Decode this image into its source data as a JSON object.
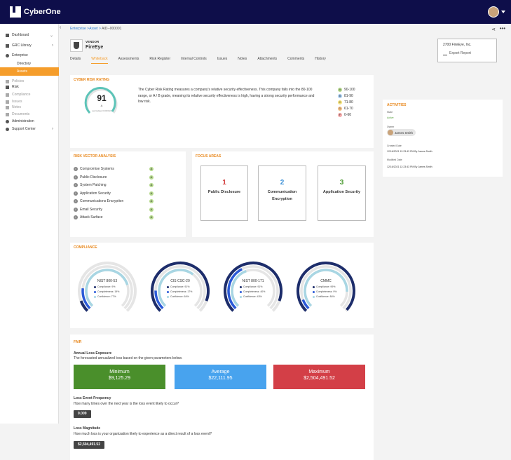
{
  "brand": {
    "name": "CyberOne"
  },
  "sidebar": {
    "items": [
      {
        "label": "Dashboard",
        "icon": "grid-icon",
        "chev": "⌄"
      },
      {
        "label": "GRC Library",
        "icon": "library-icon",
        "chev": "›"
      },
      {
        "label": "Enterprise",
        "icon": "globe-icon",
        "chev": ""
      },
      {
        "label": "Directory",
        "icon": "",
        "chev": ""
      },
      {
        "label": "Assets",
        "icon": "",
        "chev": ""
      },
      {
        "label": "Policies",
        "icon": "link-icon",
        "chev": ""
      },
      {
        "label": "Risk",
        "icon": "list-icon",
        "chev": ""
      },
      {
        "label": "Compliance",
        "icon": "doc-icon",
        "chev": ""
      },
      {
        "label": "Issues",
        "icon": "flag-icon",
        "chev": ""
      },
      {
        "label": "Notes",
        "icon": "note-icon",
        "chev": ""
      },
      {
        "label": "Documents",
        "icon": "file-icon",
        "chev": ""
      },
      {
        "label": "Administration",
        "icon": "gear-icon",
        "chev": ""
      },
      {
        "label": "Support Center",
        "icon": "help-icon",
        "chev": "›"
      }
    ]
  },
  "breadcrumb": {
    "part1": "Enterprise",
    "sep1": " >",
    "part2": "Asset",
    "sep2": " > ",
    "current": "AID--000001"
  },
  "vendor": {
    "type": "VENDOR",
    "name": "FireEye"
  },
  "tabs": [
    "Details",
    "Whiteback",
    "Assessments",
    "Risk Register",
    "Internal Controls",
    "Issues",
    "Notes",
    "Attachments",
    "Comments",
    "History"
  ],
  "address": {
    "text": "2700 FireEye, Inc.",
    "export": "Export Report"
  },
  "rating": {
    "title": "CYBER RISK RATING",
    "score": "91",
    "grade": "A",
    "updated": "Last Updated 01/06/2021",
    "text": "The Cyber Risk Rating measures a company's relative security effectiveness. This company falls into the 80-100 range, or A / B grade, meaning its relative security effectiveness is high, having a strong security performance and low risk.",
    "legend": [
      {
        "g": "A",
        "range": "90-100",
        "color": "#b5d98c"
      },
      {
        "g": "B",
        "range": "81-90",
        "color": "#a9cdf0"
      },
      {
        "g": "C",
        "range": "71-80",
        "color": "#f4e27a"
      },
      {
        "g": "D",
        "range": "61-70",
        "color": "#f6c185"
      },
      {
        "g": "F",
        "range": "0-60",
        "color": "#f2a7a7"
      }
    ]
  },
  "vectors": {
    "title": "RISK VECTOR ANALYSIS",
    "items": [
      {
        "label": "Compromise Systems",
        "grade": "A"
      },
      {
        "label": "Public Disclosure",
        "grade": "A"
      },
      {
        "label": "System Patching",
        "grade": "A"
      },
      {
        "label": "Application Security",
        "grade": "A"
      },
      {
        "label": "Communications Encryption",
        "grade": "A"
      },
      {
        "label": "Email Security",
        "grade": "A"
      },
      {
        "label": "Attack Surface",
        "grade": "A"
      }
    ]
  },
  "focus": {
    "title": "FOCUS AREAS",
    "items": [
      {
        "n": "1",
        "label": "Public Disclosure",
        "color": "#d13c3c"
      },
      {
        "n": "2",
        "label": "Communication Encryption",
        "color": "#3a8fd6"
      },
      {
        "n": "3",
        "label": "Application Security",
        "color": "#4a9a2f"
      }
    ]
  },
  "compliance": {
    "title": "COMPLIANCE",
    "frameworks": [
      {
        "name": "NIST 800-53",
        "compliance": "Compliance: 9%",
        "completeness": "Completeness: 19%",
        "confidence": "Confidence: 77%",
        "c": 0.09,
        "m": 0.19,
        "f": 0.77
      },
      {
        "name": "CIS CSC-20",
        "compliance": "Compliance: 91%",
        "completeness": "Completeness: 17%",
        "confidence": "Confidence: 64%",
        "c": 0.91,
        "m": 0.17,
        "f": 0.64
      },
      {
        "name": "NIST 800-171",
        "compliance": "Compliance: 91%",
        "completeness": "Completeness: 40%",
        "confidence": "Confidence: 43%",
        "c": 0.91,
        "m": 0.4,
        "f": 0.43
      },
      {
        "name": "CMMC",
        "compliance": "Compliance: 99%",
        "completeness": "Completeness: 9%",
        "confidence": "Confidence: 84%",
        "c": 0.99,
        "m": 0.09,
        "f": 0.84
      }
    ],
    "colors": {
      "compliance": "#1d2d6b",
      "completeness": "#2a5ad8",
      "confidence": "#a8d6e3"
    }
  },
  "fair": {
    "title": "FAIR",
    "ale_title": "Annual Loss Exposure",
    "ale_desc": "The forecasted annualized loss based on the given parameters below.",
    "boxes": [
      {
        "label": "Minimum",
        "value": "$9,125.29",
        "color": "#4a8f2b"
      },
      {
        "label": "Average",
        "value": "$22,111.95",
        "color": "#48a3ee"
      },
      {
        "label": "Maximum",
        "value": "$2,504,491.52",
        "color": "#d33f47"
      }
    ],
    "lef_title": "Loss Event Frequency",
    "lef_desc": "How many times over the next year is the loss event likely to occur?",
    "lef_value": "0.009",
    "lm_title": "Loss Magnitude",
    "lm_desc": "How much loss is your organization likely to experience as a direct result of a loss event?",
    "lm_value": "$2,504,491.52"
  },
  "activities": {
    "title": "ACTIVITIES",
    "state_label": "State",
    "state_value": "Active",
    "owner_label": "Owner",
    "owner_value": "James Smith",
    "created_label": "Created Date",
    "created_value": "12/16/2021 12:23:43 PM By James Smith",
    "modified_label": "Modified Date",
    "modified_value": "12/16/2021 12:23:43 PM By James Smith"
  }
}
